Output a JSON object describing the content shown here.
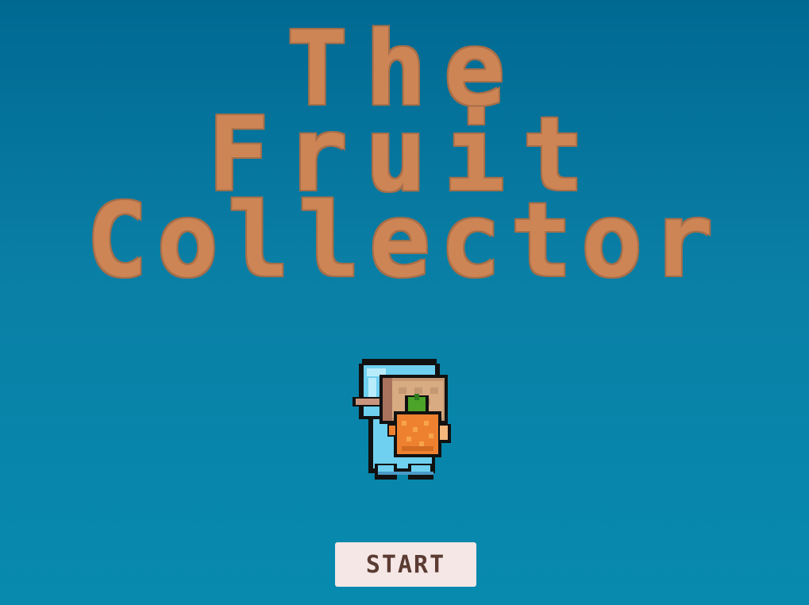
{
  "title": {
    "lines": [
      "The",
      "Fruit",
      "Collector"
    ]
  },
  "start_button": {
    "label": "START"
  },
  "colors": {
    "background_top": "#006992",
    "background_bottom": "#078aae",
    "title_fill": "#cd8555",
    "title_outline": "#a76e49",
    "button_background": "#f4e7e5",
    "button_text": "#5b3b32",
    "character_suit": "#6fd0ef",
    "character_outline": "#111111",
    "pineapple_body": "#ee8130",
    "pineapple_leaves": "#4ca428",
    "basket": "#c49872"
  },
  "icons": {
    "player": "astronaut-holding-pineapple-and-basket"
  }
}
